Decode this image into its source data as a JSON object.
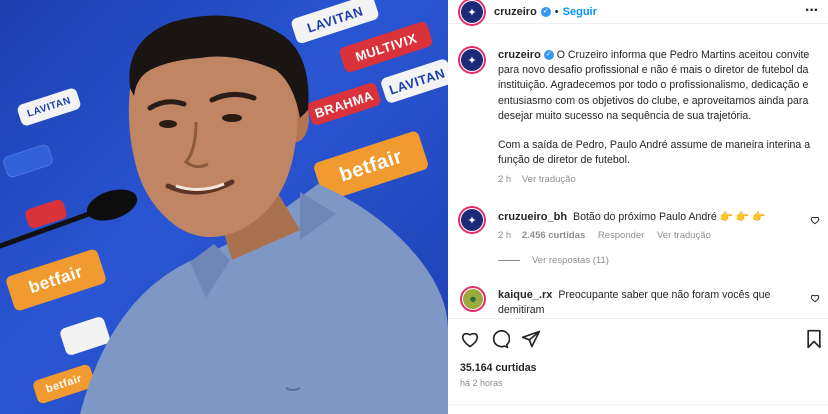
{
  "photo": {
    "sponsors": [
      "LAVITAN",
      "MULTIVIX",
      "LAVITAN",
      "BRAHMA",
      "betfair",
      "betfair",
      "LAVITAN",
      "betfair"
    ]
  },
  "post": {
    "author": "cruzeiro",
    "follow_label": "Seguir",
    "dot": "•",
    "caption_author": "cruzeiro",
    "caption_p1": "O Cruzeiro informa que Pedro Martins aceitou convite para novo desafio profissional e não é mais o diretor de futebol da instituição. Agradecemos por todo o profissionalismo, dedicação e entusiasmo com os objetivos do clube, e aproveitamos ainda para desejar muito sucesso na sequência de sua trajetória.",
    "caption_p2": "Com a saída de Pedro, Paulo André assume de maneira interina a função de diretor de futebol.",
    "caption_time": "2 h",
    "caption_translate": "Ver tradução"
  },
  "comments": [
    {
      "user": "cruzueiro_bh",
      "text": "Botão do próximo Paulo André 👉 👉 👉",
      "time": "2 h",
      "likes": "2.456 curtidas",
      "reply": "Responder",
      "translate": "Ver tradução",
      "view_replies": "Ver respostas (11)"
    },
    {
      "user": "kaique_.rx",
      "text": "Preocupante saber que não foram vocês que demitiram"
    }
  ],
  "footer": {
    "likes": "35.164 curtidas",
    "time": "há 2 horas"
  },
  "colors": {
    "accent": "#0095f6",
    "verified": "#3897f0",
    "club_blue": "#1b2a78"
  },
  "icons": [
    "heart-icon",
    "comment-icon",
    "share-icon",
    "bookmark-icon",
    "more-icon",
    "verified-icon"
  ]
}
